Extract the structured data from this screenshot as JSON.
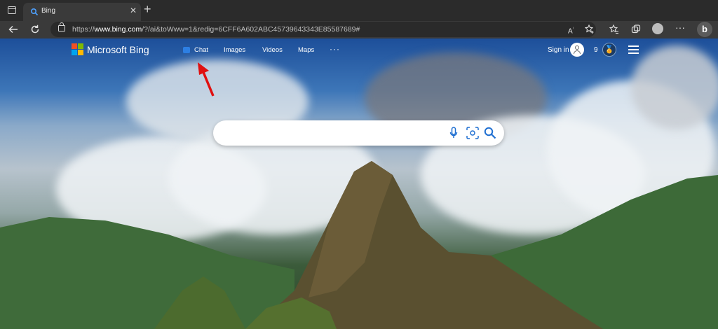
{
  "browser": {
    "tab_title": "Bing",
    "url_prefix": "https://",
    "url_domain": "www.bing.com",
    "url_rest": "/?/ai&toWww=1&redig=6CFF6A602ABC45739643343E85587689#",
    "toolbar_icons": [
      "back-arrow-icon",
      "refresh-icon",
      "read-aloud-icon",
      "favorite-add-icon",
      "favorites-icon",
      "collections-icon",
      "profile-icon",
      "more-icon",
      "bing-copilot-icon"
    ]
  },
  "header": {
    "brand": "Microsoft Bing",
    "nav": [
      "Chat",
      "Images",
      "Videos",
      "Maps"
    ],
    "more": "···",
    "sign_in": "Sign in",
    "points": "9"
  },
  "search": {
    "value": "",
    "placeholder": ""
  },
  "colors": {
    "ms_red": "#f25022",
    "ms_green": "#7fba00",
    "ms_blue": "#00a4ef",
    "ms_yellow": "#ffb900",
    "search_icons": "#1f6fd1",
    "arrow": "#e01010"
  }
}
